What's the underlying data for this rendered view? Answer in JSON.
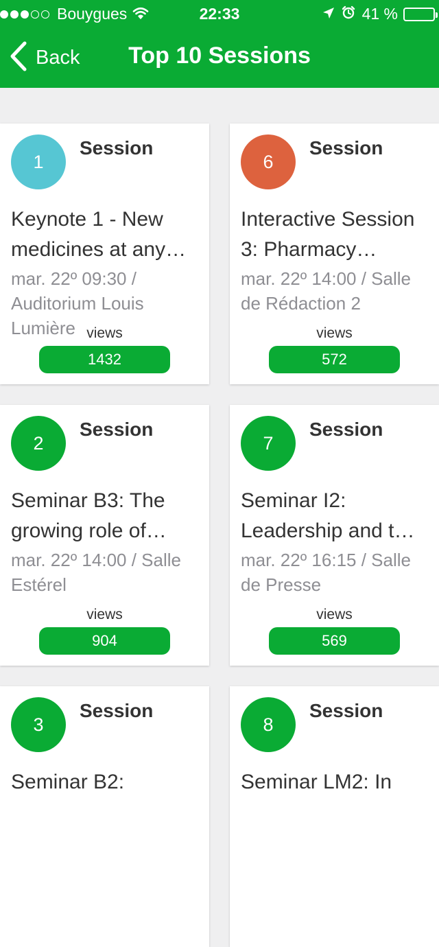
{
  "status_bar": {
    "carrier": "Bouygues",
    "time": "22:33",
    "battery_percent": "41 %",
    "battery_level": 0.41,
    "signal_bars_filled": 3,
    "signal_bars_total": 5,
    "icons": [
      "wifi-icon",
      "location-arrow-icon",
      "alarm-clock-icon",
      "battery-icon"
    ]
  },
  "nav": {
    "back_label": "Back",
    "title": "Top 10 Sessions",
    "back_icon": "chevron-left-icon"
  },
  "colors": {
    "brand_green": "#0aab34",
    "rank_1": "#56c6d3",
    "rank_6": "#dd623e",
    "rank_default": "#0aab34"
  },
  "cards": [
    {
      "rank": "1",
      "kind": "Session",
      "title": "Keynote 1 - New medicines at any…",
      "meta": "mar. 22º 09:30 / Auditorium Louis Lumière",
      "views_label": "views",
      "views": "1432",
      "color": "#56c6d3"
    },
    {
      "rank": "6",
      "kind": "Session",
      "title": "Interactive Session 3: Pharmacy…",
      "meta": "mar. 22º 14:00 / Salle de Rédaction 2",
      "views_label": "views",
      "views": "572",
      "color": "#dd623e"
    },
    {
      "rank": "2",
      "kind": "Session",
      "title": "Seminar B3: The growing role of…",
      "meta": "mar. 22º 14:00 / Salle Estérel",
      "views_label": "views",
      "views": "904",
      "color": "#0aab34"
    },
    {
      "rank": "7",
      "kind": "Session",
      "title": "Seminar I2: Leadership and t…",
      "meta": "mar. 22º 16:15 / Salle de Presse",
      "views_label": "views",
      "views": "569",
      "color": "#0aab34"
    },
    {
      "rank": "3",
      "kind": "Session",
      "title": "Seminar B2:",
      "meta": "",
      "views_label": "",
      "views": "",
      "color": "#0aab34"
    },
    {
      "rank": "8",
      "kind": "Session",
      "title": "Seminar LM2: In",
      "meta": "",
      "views_label": "",
      "views": "",
      "color": "#0aab34"
    }
  ]
}
